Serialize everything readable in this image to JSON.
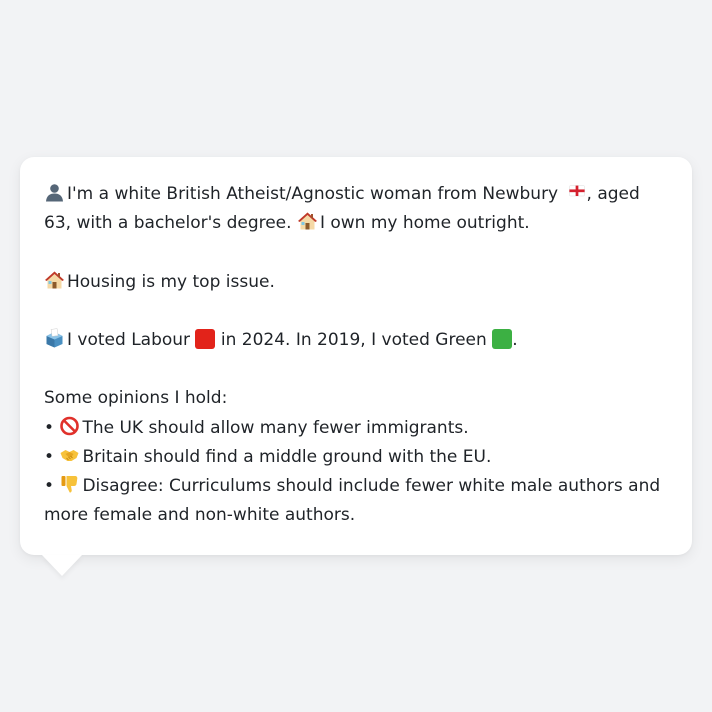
{
  "profile": {
    "line1_pre": "I'm a white British Atheist/Agnostic woman from Newbury",
    "line1_post": ", aged 63, with a bachelor's degree.",
    "line1_home": "I own my home outright.",
    "top_issue": "Housing is my top issue.",
    "vote_pre": "I voted Labour",
    "vote_mid": "in 2024. In 2019, I voted Green",
    "vote_post": ".",
    "opinions_heading": "Some opinions I hold:",
    "bullet_char": "•",
    "opinions": [
      {
        "icon": "prohibited-icon",
        "text": "The UK should allow many fewer immigrants."
      },
      {
        "icon": "handshake-icon",
        "text": "Britain should find a middle ground with the EU."
      },
      {
        "icon": "thumbs-down-icon",
        "text": "Disagree: Curriculums should include fewer white male authors and more female and non-white authors."
      }
    ]
  },
  "colors": {
    "labour": "#e2231a",
    "green": "#3cb043",
    "background": "#f2f3f5",
    "card": "#ffffff",
    "text": "#1f2328"
  }
}
